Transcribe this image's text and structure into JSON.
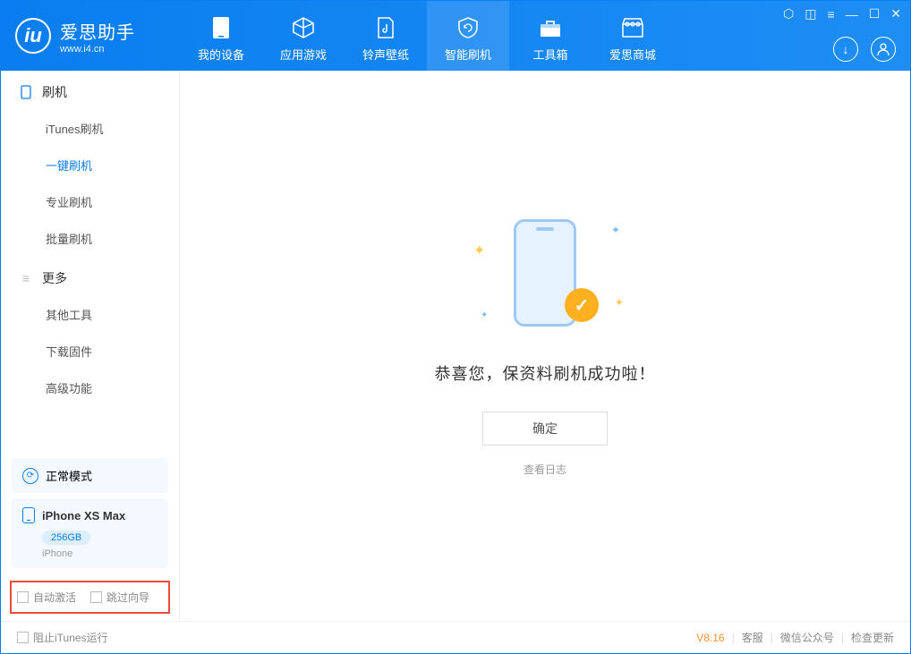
{
  "app": {
    "name": "爱思助手",
    "url": "www.i4.cn"
  },
  "tabs": [
    {
      "label": "我的设备"
    },
    {
      "label": "应用游戏"
    },
    {
      "label": "铃声壁纸"
    },
    {
      "label": "智能刷机"
    },
    {
      "label": "工具箱"
    },
    {
      "label": "爱思商城"
    }
  ],
  "sidebar": {
    "section1": {
      "title": "刷机",
      "items": [
        "iTunes刷机",
        "一键刷机",
        "专业刷机",
        "批量刷机"
      ]
    },
    "section2": {
      "title": "更多",
      "items": [
        "其他工具",
        "下载固件",
        "高级功能"
      ]
    }
  },
  "mode_box": {
    "label": "正常模式"
  },
  "device": {
    "name": "iPhone XS Max",
    "capacity": "256GB",
    "type": "iPhone"
  },
  "checkboxes": {
    "auto_activate": "自动激活",
    "skip_guide": "跳过向导"
  },
  "main": {
    "success_message": "恭喜您，保资料刷机成功啦！",
    "ok_button": "确定",
    "view_log": "查看日志"
  },
  "footer": {
    "block_itunes": "阻止iTunes运行",
    "version": "V8.16",
    "links": [
      "客服",
      "微信公众号",
      "检查更新"
    ]
  }
}
